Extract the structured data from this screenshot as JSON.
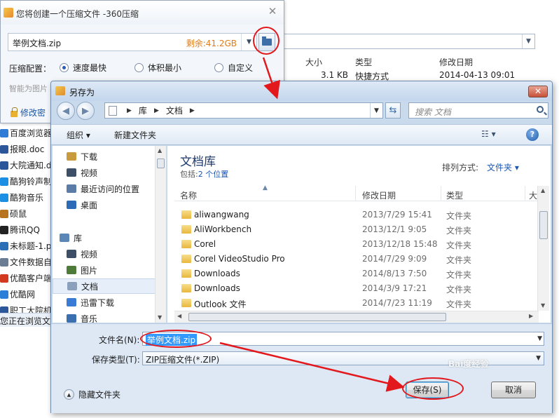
{
  "background_window": {
    "columns": [
      "大小",
      "类型",
      "修改日期"
    ],
    "first_row": {
      "size": "3.1 KB",
      "type": "快捷方式",
      "date": "2014-04-13 09:01"
    },
    "side_items": [
      {
        "label": "百度浏览器",
        "icon": "browser-icon",
        "color": "#2f7cd6"
      },
      {
        "label": "报眼.doc",
        "icon": "word-doc-icon",
        "color": "#2b579a"
      },
      {
        "label": "大院通知.d",
        "icon": "word-doc-icon",
        "color": "#2b579a"
      },
      {
        "label": "酷狗铃声制",
        "icon": "kugou-icon",
        "color": "#1a8fe3"
      },
      {
        "label": "酷狗音乐",
        "icon": "kugou-icon",
        "color": "#1a8fe3"
      },
      {
        "label": "硕鼠",
        "icon": "mouse-icon",
        "color": "#b8731f"
      },
      {
        "label": "腾讯QQ",
        "icon": "qq-icon",
        "color": "#222222"
      },
      {
        "label": "未标题-1.p",
        "icon": "image-file-icon",
        "color": "#2d6fb7"
      },
      {
        "label": "文件数据自",
        "icon": "file-icon",
        "color": "#6b7d92"
      },
      {
        "label": "优酷客户端",
        "icon": "youku-icon",
        "color": "#d2391e"
      },
      {
        "label": "优酷网",
        "icon": "youku-icon",
        "color": "#2c7fd8"
      },
      {
        "label": "职工大院机",
        "icon": "word-doc-icon",
        "color": "#2b579a"
      }
    ],
    "status": "您正在浏览文"
  },
  "zip_window": {
    "title": "您将创建一个压缩文件 -360压缩",
    "filename": "举例文档.zip",
    "free_space": "剩余:41.2GB",
    "config_label": "压缩配置：",
    "options": [
      {
        "label": "速度最快",
        "selected": true
      },
      {
        "label": "体积最小",
        "selected": false
      },
      {
        "label": "自定义",
        "selected": false
      }
    ],
    "hint": "智能为图片",
    "password_link": "修改密"
  },
  "dialog": {
    "title": "另存为",
    "breadcrumb": [
      "库",
      "文档"
    ],
    "search_placeholder": "搜索 文档",
    "toolbar": {
      "organize": "组织 ▾",
      "new_folder": "新建文件夹",
      "views": "☷ ▾",
      "help": "?"
    },
    "nav_items": [
      {
        "label": "下载",
        "icon": "download-folder-icon",
        "color": "#c89b3c"
      },
      {
        "label": "视频",
        "icon": "video-icon",
        "color": "#3c4f66"
      },
      {
        "label": "最近访问的位置",
        "icon": "recent-places-icon",
        "color": "#5b7ca6"
      },
      {
        "label": "桌面",
        "icon": "desktop-icon",
        "color": "#2c6bb5"
      },
      {
        "label": "库",
        "icon": "library-icon",
        "color": "#5b86b8"
      },
      {
        "label": "视频",
        "icon": "video-icon",
        "color": "#3c4f66"
      },
      {
        "label": "图片",
        "icon": "pictures-icon",
        "color": "#4f7b3a"
      },
      {
        "label": "文档",
        "icon": "documents-icon",
        "color": "#8aa0bb"
      },
      {
        "label": "迅雷下载",
        "icon": "thunder-icon",
        "color": "#3a7bd5"
      },
      {
        "label": "音乐",
        "icon": "music-icon",
        "color": "#3a6fb0"
      }
    ],
    "library_title": "文档库",
    "library_sub_prefix": "包括:",
    "library_sub_link": "2 个位置",
    "arrange_label": "排列方式:",
    "arrange_value": "文件夹 ▾",
    "columns": {
      "name": "名称",
      "date": "修改日期",
      "type": "类型",
      "extra": "大"
    },
    "files": [
      {
        "name": "aliwangwang",
        "date": "2013/7/29 15:41",
        "type": "文件夹"
      },
      {
        "name": "AliWorkbench",
        "date": "2013/12/1 9:05",
        "type": "文件夹"
      },
      {
        "name": "Corel",
        "date": "2013/12/18 15:48",
        "type": "文件夹"
      },
      {
        "name": "Corel VideoStudio Pro",
        "date": "2014/7/29 9:09",
        "type": "文件夹"
      },
      {
        "name": "Downloads",
        "date": "2014/8/13 7:50",
        "type": "文件夹"
      },
      {
        "name": "Downloads",
        "date": "2014/3/9 17:21",
        "type": "文件夹"
      },
      {
        "name": "Outlook 文件",
        "date": "2014/7/23 11:19",
        "type": "文件夹"
      }
    ],
    "filename_label": "文件名(N):",
    "filename_value": "举例文档.zip",
    "filetype_label": "保存类型(T):",
    "filetype_value": "ZIP压缩文件(*.ZIP)",
    "hide_folders": "隐藏文件夹",
    "save_button": "保存(S)",
    "cancel_button": "取消"
  },
  "watermark": "Bai度经验",
  "colors": {
    "annotation_red": "#e3181c",
    "accent_blue": "#1a57b2",
    "free_space_orange": "#e07c14"
  }
}
